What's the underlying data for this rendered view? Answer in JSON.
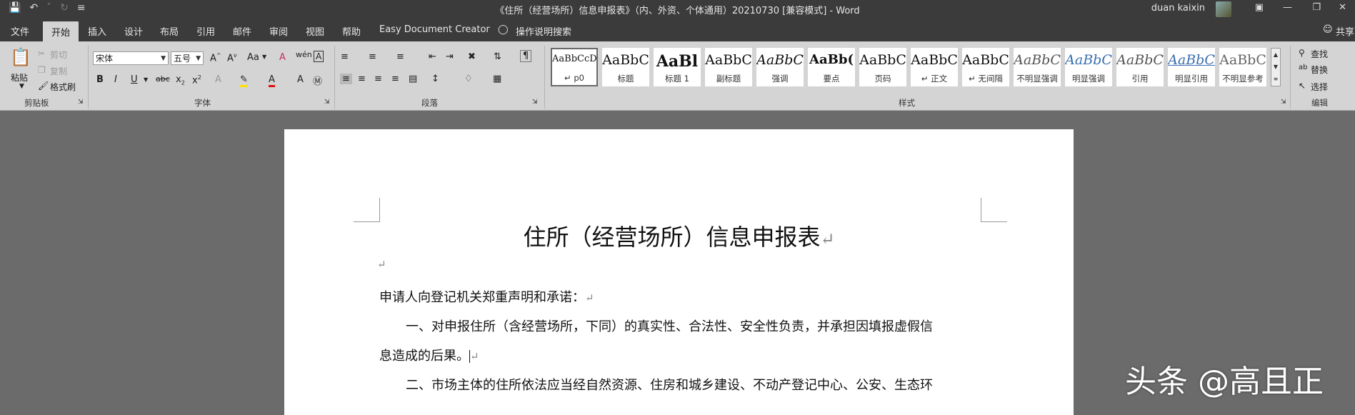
{
  "window": {
    "title": "《住所（经营场所）信息申报表》（内、外资、个体通用）20210730 [兼容模式] - Word",
    "user": "duan kaixin",
    "qat_icons": [
      "save-icon",
      "undo-icon",
      "redo-icon",
      "customize-icon"
    ]
  },
  "tabs": [
    "文件",
    "开始",
    "插入",
    "设计",
    "布局",
    "引用",
    "邮件",
    "审阅",
    "视图",
    "帮助",
    "Easy Document Creator",
    "操作说明搜索"
  ],
  "share": "共享",
  "clipboard": {
    "paste": "粘贴",
    "cut": "剪切",
    "copy": "复制",
    "format_painter": "格式刷",
    "label": "剪贴板"
  },
  "font": {
    "name": "宋体",
    "size": "五号",
    "case": "Aa",
    "label": "字体"
  },
  "paragraph": {
    "label": "段落"
  },
  "styles": {
    "label": "样式",
    "items": [
      {
        "sample": "AaBbCcDdI",
        "name": "↵ p0"
      },
      {
        "sample": "AaBbC",
        "name": "标题"
      },
      {
        "sample": "AaBl",
        "name": "标题 1"
      },
      {
        "sample": "AaBbC",
        "name": "副标题"
      },
      {
        "sample": "AaBbC",
        "name": "强调"
      },
      {
        "sample": "AaBb(",
        "name": "要点"
      },
      {
        "sample": "AaBbC",
        "name": "页码"
      },
      {
        "sample": "AaBbC",
        "name": "↵ 正文"
      },
      {
        "sample": "AaBbC",
        "name": "↵ 无间隔"
      },
      {
        "sample": "AaBbC",
        "name": "不明显强调"
      },
      {
        "sample": "AaBbC",
        "name": "明显强调"
      },
      {
        "sample": "AaBbC",
        "name": "引用"
      },
      {
        "sample": "AaBbC",
        "name": "明显引用"
      },
      {
        "sample": "AaBbC",
        "name": "不明显参考"
      }
    ]
  },
  "editing": {
    "find": "查找",
    "replace": "替换",
    "select": "选择",
    "label": "编辑"
  },
  "document": {
    "heading": "住所（经营场所）信息申报表",
    "para_mark": "↵",
    "line1": "申请人向登记机关郑重声明和承诺：",
    "line2": "一、对申报住所（含经营场所，下同）的真实性、合法性、安全性负责，并承担因填报虚假信",
    "line3": "息造成的后果。",
    "line4": "二、市场主体的住所依法应当经自然资源、住房和城乡建设、不动产登记中心、公安、生态环"
  },
  "watermark": "头条 @高且正"
}
